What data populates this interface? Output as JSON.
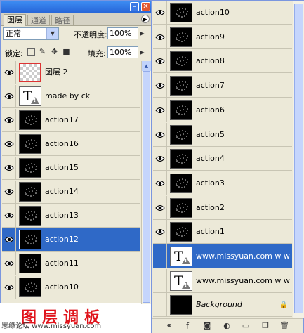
{
  "left_panel": {
    "tabs": [
      "图层",
      "通道",
      "路径"
    ],
    "blend_mode": "正常",
    "opacity_label": "不透明度:",
    "opacity_value": "100%",
    "lock_label": "锁定:",
    "fill_label": "填充:",
    "fill_value": "100%",
    "layers": [
      {
        "name": "图层 2",
        "thumb": "transparent"
      },
      {
        "name": "made by ck",
        "thumb": "text"
      },
      {
        "name": "action17",
        "thumb": "dark"
      },
      {
        "name": "action16",
        "thumb": "dark"
      },
      {
        "name": "action15",
        "thumb": "dark"
      },
      {
        "name": "action14",
        "thumb": "dark"
      },
      {
        "name": "action13",
        "thumb": "dark"
      },
      {
        "name": "action12",
        "thumb": "dark",
        "selected": true
      },
      {
        "name": "action11",
        "thumb": "dark"
      },
      {
        "name": "action10",
        "thumb": "dark"
      }
    ]
  },
  "right_panel": {
    "layers": [
      {
        "name": "action10",
        "thumb": "dark"
      },
      {
        "name": "action9",
        "thumb": "dark"
      },
      {
        "name": "action8",
        "thumb": "dark"
      },
      {
        "name": "action7",
        "thumb": "dark"
      },
      {
        "name": "action6",
        "thumb": "dark"
      },
      {
        "name": "action5",
        "thumb": "dark"
      },
      {
        "name": "action4",
        "thumb": "dark"
      },
      {
        "name": "action3",
        "thumb": "dark"
      },
      {
        "name": "action2",
        "thumb": "dark"
      },
      {
        "name": "action1",
        "thumb": "dark"
      },
      {
        "name": "www.missyuan.com   w w",
        "thumb": "text",
        "selected": true
      },
      {
        "name": "www.missyuan.com   w w",
        "thumb": "text"
      },
      {
        "name": "Background",
        "thumb": "dark"
      }
    ]
  },
  "caption": "图层调板",
  "credit": "思缘论坛 www.missyuan.com",
  "colors": {
    "selected": "#2f69c7",
    "caption": "#e0141c",
    "panel": "#ece9d8"
  }
}
